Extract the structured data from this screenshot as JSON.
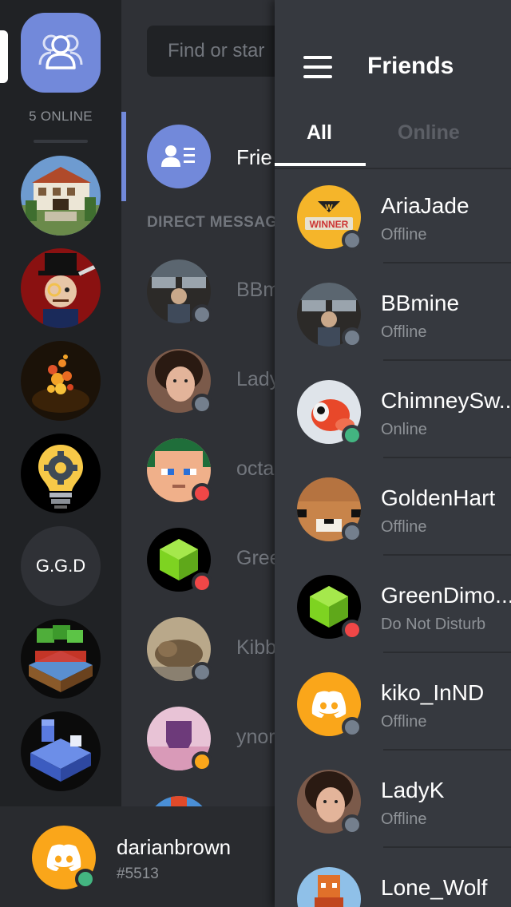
{
  "rail": {
    "online_label": "5 ONLINE",
    "servers": [
      {
        "name": "server-mansion",
        "label": ""
      },
      {
        "name": "server-monocle-bot",
        "label": ""
      },
      {
        "name": "server-fire",
        "label": ""
      },
      {
        "name": "server-bulb-gear",
        "label": ""
      },
      {
        "name": "server-ggd",
        "label": "G.G.D"
      },
      {
        "name": "server-csm",
        "label": ""
      },
      {
        "name": "server-iso-blocks",
        "label": ""
      }
    ]
  },
  "dms": {
    "search_placeholder": "Find or star",
    "friends_label": "Frie",
    "heading": "DIRECT MESSAGES",
    "items": [
      {
        "name": "BBmine",
        "status": "offline"
      },
      {
        "name": "LadyK",
        "status": "offline"
      },
      {
        "name": "octa",
        "status": "dnd"
      },
      {
        "name": "GreenDimo",
        "status": "dnd"
      },
      {
        "name": "Kibb",
        "status": "offline"
      },
      {
        "name": "ynor",
        "status": "idle"
      }
    ]
  },
  "user": {
    "name": "darianbrown",
    "tag": "#5513",
    "status": "online"
  },
  "panel": {
    "title": "Friends",
    "tabs": [
      "All",
      "Online"
    ],
    "active_tab": "All",
    "friends": [
      {
        "name": "AriaJade",
        "status_text": "Offline",
        "status": "offline",
        "avatar": "winner-badge"
      },
      {
        "name": "BBmine",
        "status_text": "Offline",
        "status": "offline",
        "avatar": "cockpit-photo"
      },
      {
        "name": "ChimneySw...",
        "status_text": "Online",
        "status": "online",
        "avatar": "goldfish"
      },
      {
        "name": "GoldenHart",
        "status_text": "Offline",
        "status": "offline",
        "avatar": "pixel-face-brown"
      },
      {
        "name": "GreenDimo...",
        "status_text": "Do Not Disturb",
        "status": "dnd",
        "avatar": "green-cube"
      },
      {
        "name": "kiko_InND",
        "status_text": "Offline",
        "status": "offline",
        "avatar": "discord-default-orange"
      },
      {
        "name": "LadyK",
        "status_text": "Offline",
        "status": "offline",
        "avatar": "selfie-photo"
      },
      {
        "name": "Lone_Wolf",
        "status_text": "",
        "status": "",
        "avatar": "pixel-fox"
      }
    ]
  },
  "colors": {
    "blurple": "#7289da",
    "online": "#43b581",
    "idle": "#faa61a",
    "dnd": "#f04747",
    "offline": "#747f8d"
  }
}
